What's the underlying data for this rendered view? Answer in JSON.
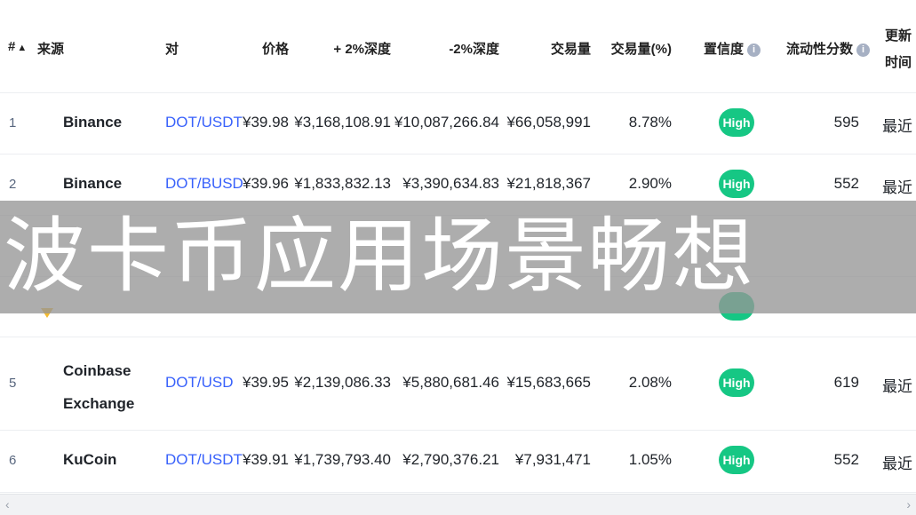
{
  "header": {
    "rank": "#",
    "sort_arrow": "▲",
    "source": "来源",
    "pair": "对",
    "price": "价格",
    "plus2_depth": "+ 2%深度",
    "minus2_depth": "-2%深度",
    "volume": "交易量",
    "volume_pct": "交易量(%)",
    "confidence": "置信度",
    "liquidity": "流动性分数",
    "updated_line1": "更新",
    "updated_line2": "时间",
    "info_glyph": "i"
  },
  "rows": [
    {
      "rank": "1",
      "source": "Binance",
      "pair": "DOT/USDT",
      "price": "¥39.98",
      "plus2": "¥3,168,108.91",
      "minus2": "¥10,087,266.84",
      "volume": "¥66,058,991",
      "volume_pct": "8.78%",
      "confidence": "High",
      "liquidity": "595",
      "updated": "最近"
    },
    {
      "rank": "2",
      "source": "Binance",
      "pair": "DOT/BUSD",
      "price": "¥39.96",
      "plus2": "¥1,833,832.13",
      "minus2": "¥3,390,634.83",
      "volume": "¥21,818,367",
      "volume_pct": "2.90%",
      "confidence": "High",
      "liquidity": "552",
      "updated": "最近"
    },
    {
      "rank": "5",
      "source_line1": "Coinbase",
      "source_line2": "Exchange",
      "pair": "DOT/USD",
      "price": "¥39.95",
      "plus2": "¥2,139,086.33",
      "minus2": "¥5,880,681.46",
      "volume": "¥15,683,665",
      "volume_pct": "2.08%",
      "confidence": "High",
      "liquidity": "619",
      "updated": "最近"
    },
    {
      "rank": "6",
      "source": "KuCoin",
      "pair": "DOT/USDT",
      "price": "¥39.91",
      "plus2": "¥1,739,793.40",
      "minus2": "¥2,790,376.21",
      "volume": "¥7,931,471",
      "volume_pct": "1.05%",
      "confidence": "High",
      "liquidity": "552",
      "updated": "最近"
    }
  ],
  "overlay_banner": "波卡币应用场景畅想",
  "scrollbar": {
    "left_arrow": "‹",
    "right_arrow": "›"
  },
  "colors": {
    "accent_link": "#3861fb",
    "high_badge": "#16c784",
    "binance_icon": "#f3ba2f"
  }
}
